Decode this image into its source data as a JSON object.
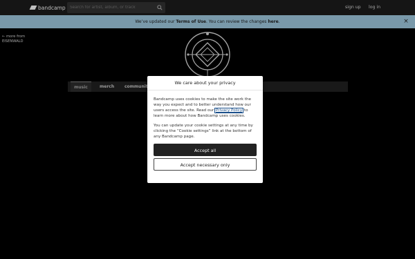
{
  "header": {
    "logo_text": "bandcamp",
    "search_placeholder": "Search for artist, album, or track",
    "sign_up": "sign up",
    "log_in": "log in"
  },
  "banner": {
    "prefix": "We’ve updated our ",
    "terms_link": "Terms of Use",
    "middle": ". You can review the changes ",
    "here_link": "here",
    "suffix": ".",
    "close_glyph": "×"
  },
  "more_from": {
    "arrow_label": "← more from",
    "artist": "EISENWALD"
  },
  "artist_nav": {
    "tabs": [
      {
        "label": "music"
      },
      {
        "label": "merch"
      },
      {
        "label": "community"
      }
    ]
  },
  "cookie_modal": {
    "title": "We care about your privacy",
    "para1_before": "Bandcamp uses cookies to make the site work the way you expect and to better understand how our users access the site. Read our ",
    "privacy_link": "Privacy Policy",
    "para1_after": " to learn more about how Bandcamp uses cookies.",
    "para2": "You can update your cookie settings at any time by clicking the “Cookie settings” link at the bottom of any Bandcamp page.",
    "accept_all": "Accept all",
    "accept_necessary": "Accept necessary only"
  },
  "colors": {
    "banner_bg": "#a2cce3",
    "topbar_bg": "#1c1c1c",
    "page_bg": "#000000",
    "primary_button": "#222222"
  }
}
